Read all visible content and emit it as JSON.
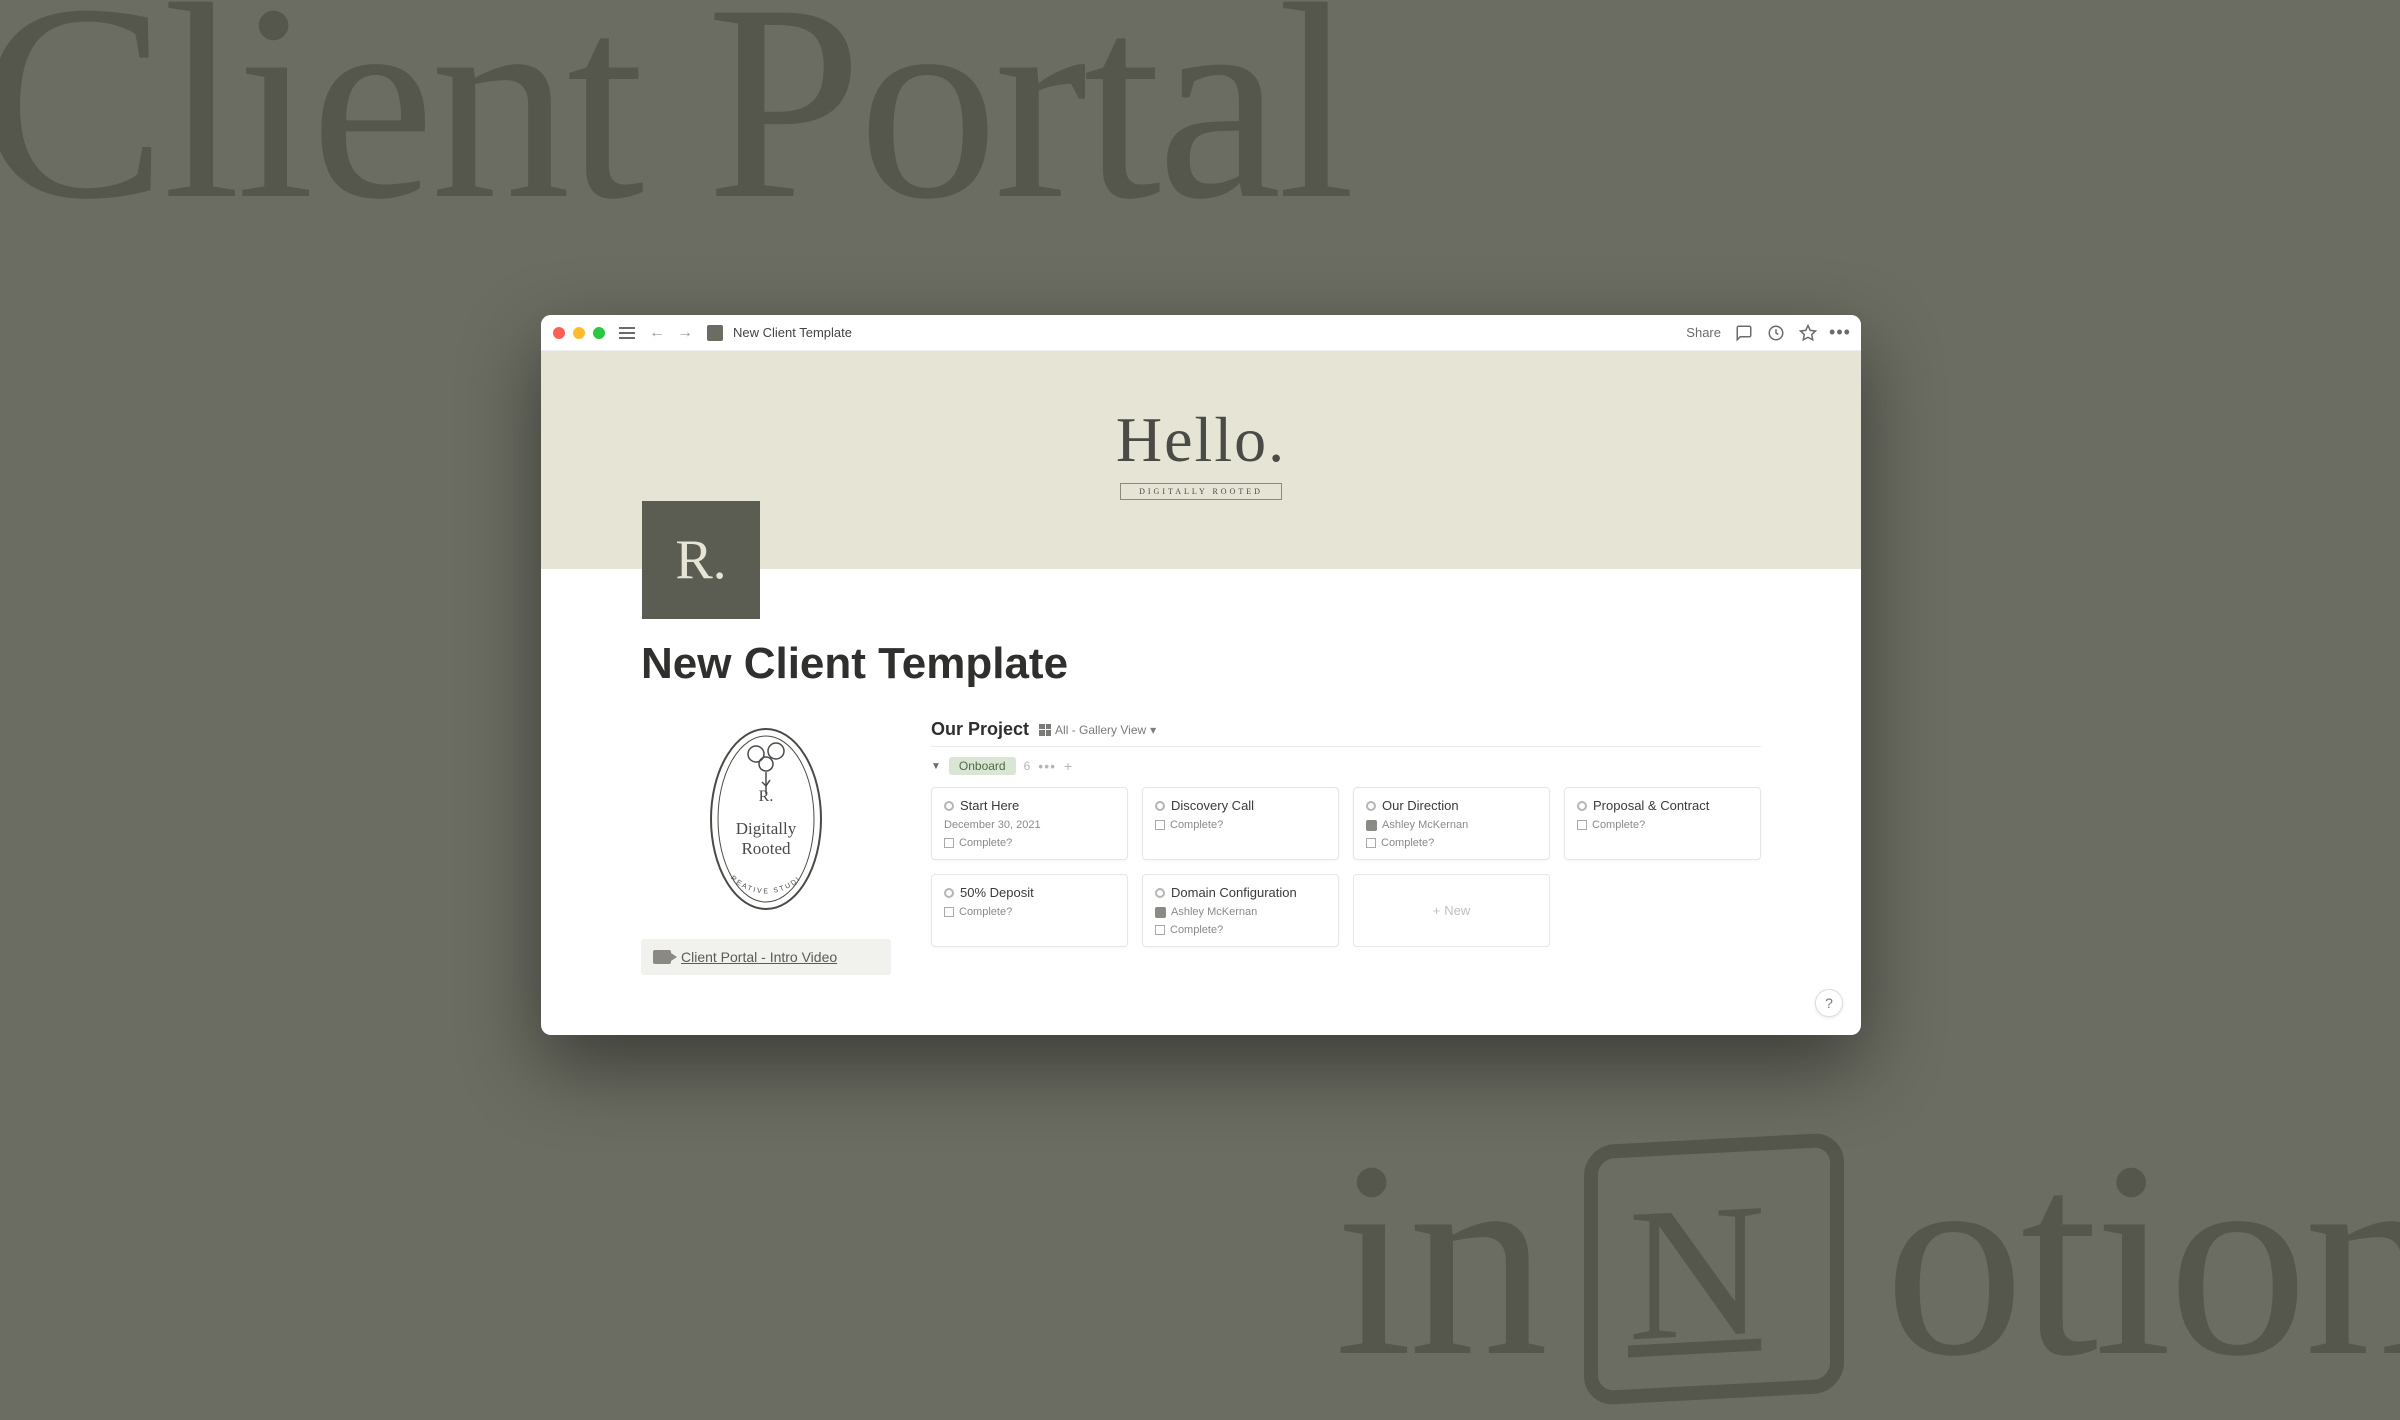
{
  "background": {
    "top_text": "Client Portal",
    "bottom_prefix": "in",
    "bottom_suffix": "otion"
  },
  "window": {
    "title": "New Client Template",
    "share_label": "Share"
  },
  "cover": {
    "hello": "Hello.",
    "subtitle": "DIGITALLY ROOTED",
    "icon_letter": "R."
  },
  "page": {
    "title": "New Client Template"
  },
  "left_column": {
    "brand_top": "Digitally",
    "brand_bottom": "Rooted",
    "brand_sub": "CREATIVE STUDIO",
    "video_link": "Client Portal - Intro Video"
  },
  "database": {
    "title": "Our Project",
    "view_label": "All - Gallery View",
    "group": {
      "tag": "Onboard",
      "count": "6",
      "new_label": "New"
    },
    "cards": [
      {
        "title": "Start Here",
        "meta1_type": "date",
        "meta1": "December 30, 2021",
        "meta2_type": "checkbox",
        "meta2": "Complete?"
      },
      {
        "title": "Discovery Call",
        "meta1_type": "checkbox",
        "meta1": "Complete?",
        "meta2_type": "",
        "meta2": ""
      },
      {
        "title": "Our Direction",
        "meta1_type": "person",
        "meta1": "Ashley McKernan",
        "meta2_type": "checkbox",
        "meta2": "Complete?"
      },
      {
        "title": "Proposal & Contract",
        "meta1_type": "checkbox",
        "meta1": "Complete?",
        "meta2_type": "",
        "meta2": ""
      },
      {
        "title": "50% Deposit",
        "meta1_type": "checkbox",
        "meta1": "Complete?",
        "meta2_type": "",
        "meta2": ""
      },
      {
        "title": "Domain Configuration",
        "meta1_type": "person",
        "meta1": "Ashley McKernan",
        "meta2_type": "checkbox",
        "meta2": "Complete?"
      }
    ]
  },
  "help_label": "?"
}
